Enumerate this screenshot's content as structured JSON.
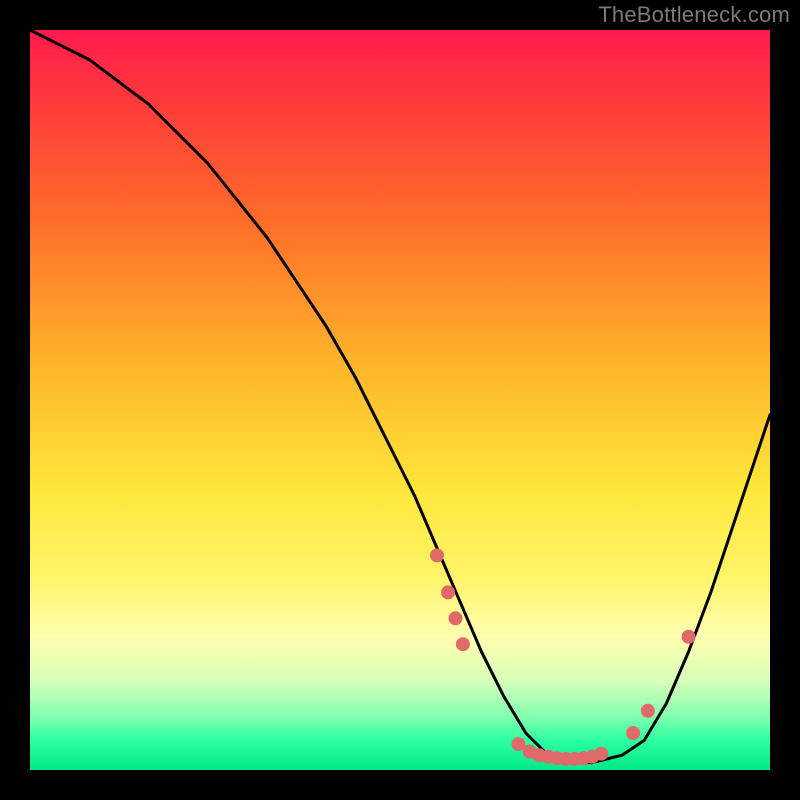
{
  "watermark": "TheBottleneck.com",
  "chart_data": {
    "type": "line",
    "title": "",
    "xlabel": "",
    "ylabel": "",
    "xlim": [
      0,
      100
    ],
    "ylim": [
      0,
      100
    ],
    "curve": {
      "x": [
        0,
        4,
        8,
        12,
        16,
        20,
        24,
        28,
        32,
        36,
        40,
        44,
        48,
        52,
        55,
        58,
        61,
        64,
        67,
        70,
        73,
        76,
        80,
        83,
        86,
        89,
        92,
        95,
        98,
        100
      ],
      "y": [
        100,
        98,
        96,
        93,
        90,
        86,
        82,
        77,
        72,
        66,
        60,
        53,
        45,
        37,
        30,
        23,
        16,
        10,
        5,
        2,
        1,
        1,
        2,
        4,
        9,
        16,
        24,
        33,
        42,
        48
      ]
    },
    "points": [
      {
        "x": 55.0,
        "y": 29.0
      },
      {
        "x": 56.5,
        "y": 24.0
      },
      {
        "x": 57.5,
        "y": 20.5
      },
      {
        "x": 58.5,
        "y": 17.0
      },
      {
        "x": 66.0,
        "y": 3.5
      },
      {
        "x": 67.5,
        "y": 2.5
      },
      {
        "x": 68.8,
        "y": 2.0
      },
      {
        "x": 70.0,
        "y": 1.8
      },
      {
        "x": 71.2,
        "y": 1.6
      },
      {
        "x": 72.4,
        "y": 1.5
      },
      {
        "x": 73.6,
        "y": 1.5
      },
      {
        "x": 74.8,
        "y": 1.6
      },
      {
        "x": 76.0,
        "y": 1.8
      },
      {
        "x": 77.2,
        "y": 2.2
      },
      {
        "x": 81.5,
        "y": 5.0
      },
      {
        "x": 83.5,
        "y": 8.0
      },
      {
        "x": 89.0,
        "y": 18.0
      }
    ],
    "point_color": "#e06a6a",
    "line_color": "#000000"
  }
}
